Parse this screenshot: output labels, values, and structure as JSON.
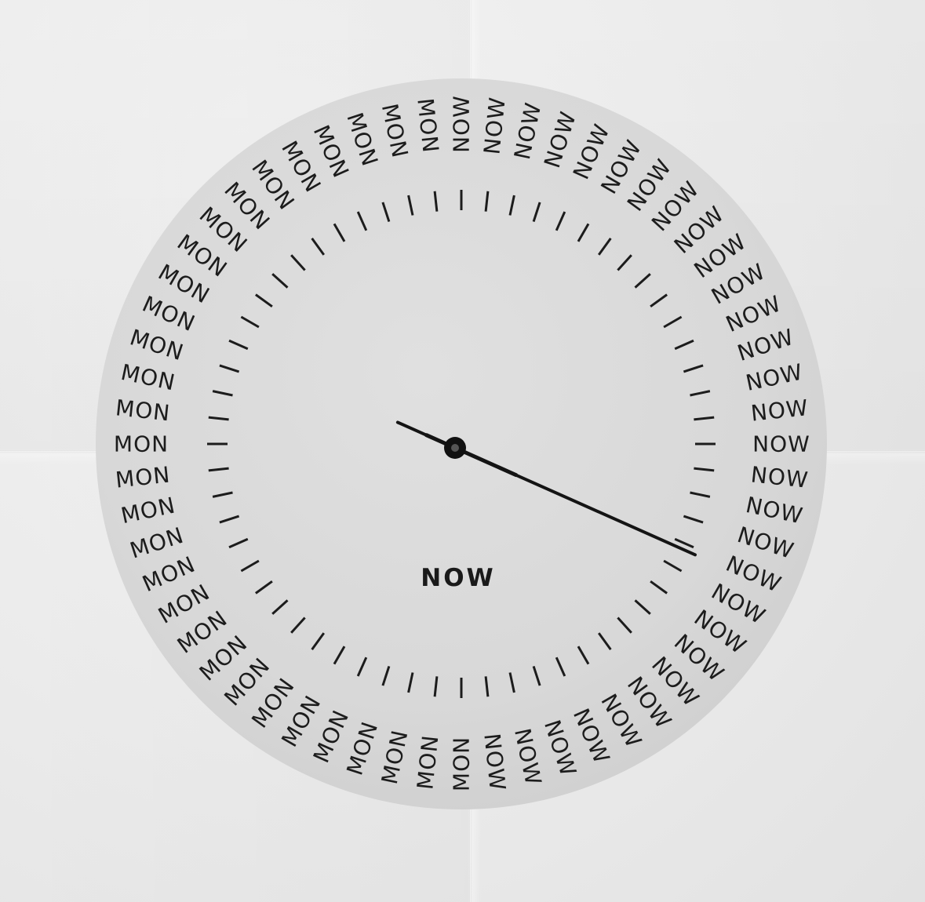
{
  "dial": {
    "ring_word_right": "NOW",
    "ring_word_left": "MON",
    "ring_count": 60,
    "center_label": "NOW",
    "face_color": "#d9d9d9",
    "ink_color": "#1c1c1c",
    "paper_color": "#ebebeb"
  },
  "hands": {
    "minute_value": 19,
    "hour_value": 19
  }
}
